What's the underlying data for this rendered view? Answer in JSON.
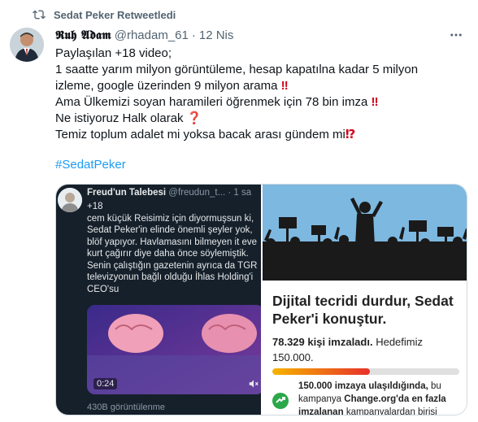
{
  "retweet": {
    "icon": "retweet-icon",
    "label": "Sedat Peker Retweetledi"
  },
  "tweet": {
    "author_name": "𝕽𝖚𝖍 𝕬𝖉𝖆𝖒",
    "handle": "@rhadam_61",
    "separator": "·",
    "time": "12 Nis",
    "lines": [
      "Paylaşılan +18 video;",
      "1 saatte yarım milyon görüntüleme, hesap kapatılna kadar 5 milyon",
      "izleme, google üzerinden 9 milyon arama",
      "Ama Ülkemizi soyan haramileri öğrenmek için 78 bin imza",
      "Ne istiyoruz Halk olarak",
      "Temiz toplum adalet mi yoksa bacak arası gündem mi"
    ],
    "emojis": {
      "line3": "‼",
      "line4": "‼",
      "line5": "❓",
      "line6": "⁉"
    },
    "hashtag": "#SedatPeker"
  },
  "embedded_tweet": {
    "author_name": "Freud'un Talebesi",
    "handle": "@freudun_t...",
    "separator": "·",
    "time": "1 sa",
    "lines": [
      "+18",
      "cem küçük Reisimiz için diyormuşsun ki,",
      "Sedat Peker'in elinde önemli şeyler yok,",
      "blöf yapıyor. Havlamasını bilmeyen it eve",
      "kurt çağırır diye daha önce söylemiştik.",
      "Senin çalıştığın gazetenin ayrıca da TGR",
      "televizyonun bağlı olduğu İhlas Holding'i",
      "CEO'su"
    ],
    "video_time": "0:24",
    "views": "430B görüntülenme"
  },
  "petition": {
    "title": "Dijital tecridi durdur, Sedat Peker'i konuştur.",
    "signatures": "78.329 kişi imzaladı.",
    "goal_text": "Hedefimiz 150.000.",
    "progress_fraction": 0.52,
    "goal_bold": "150.000 imzaya ulaşıldığında,",
    "goal_rest1": "bu kampanya",
    "goal_bold2": "Change.org'da en fazla imzalanan",
    "goal_rest2": "kampanyalardan birisi"
  },
  "colors": {
    "link": "#1d9bf0",
    "muted": "#536471",
    "emoji_red": "#d0021b"
  }
}
